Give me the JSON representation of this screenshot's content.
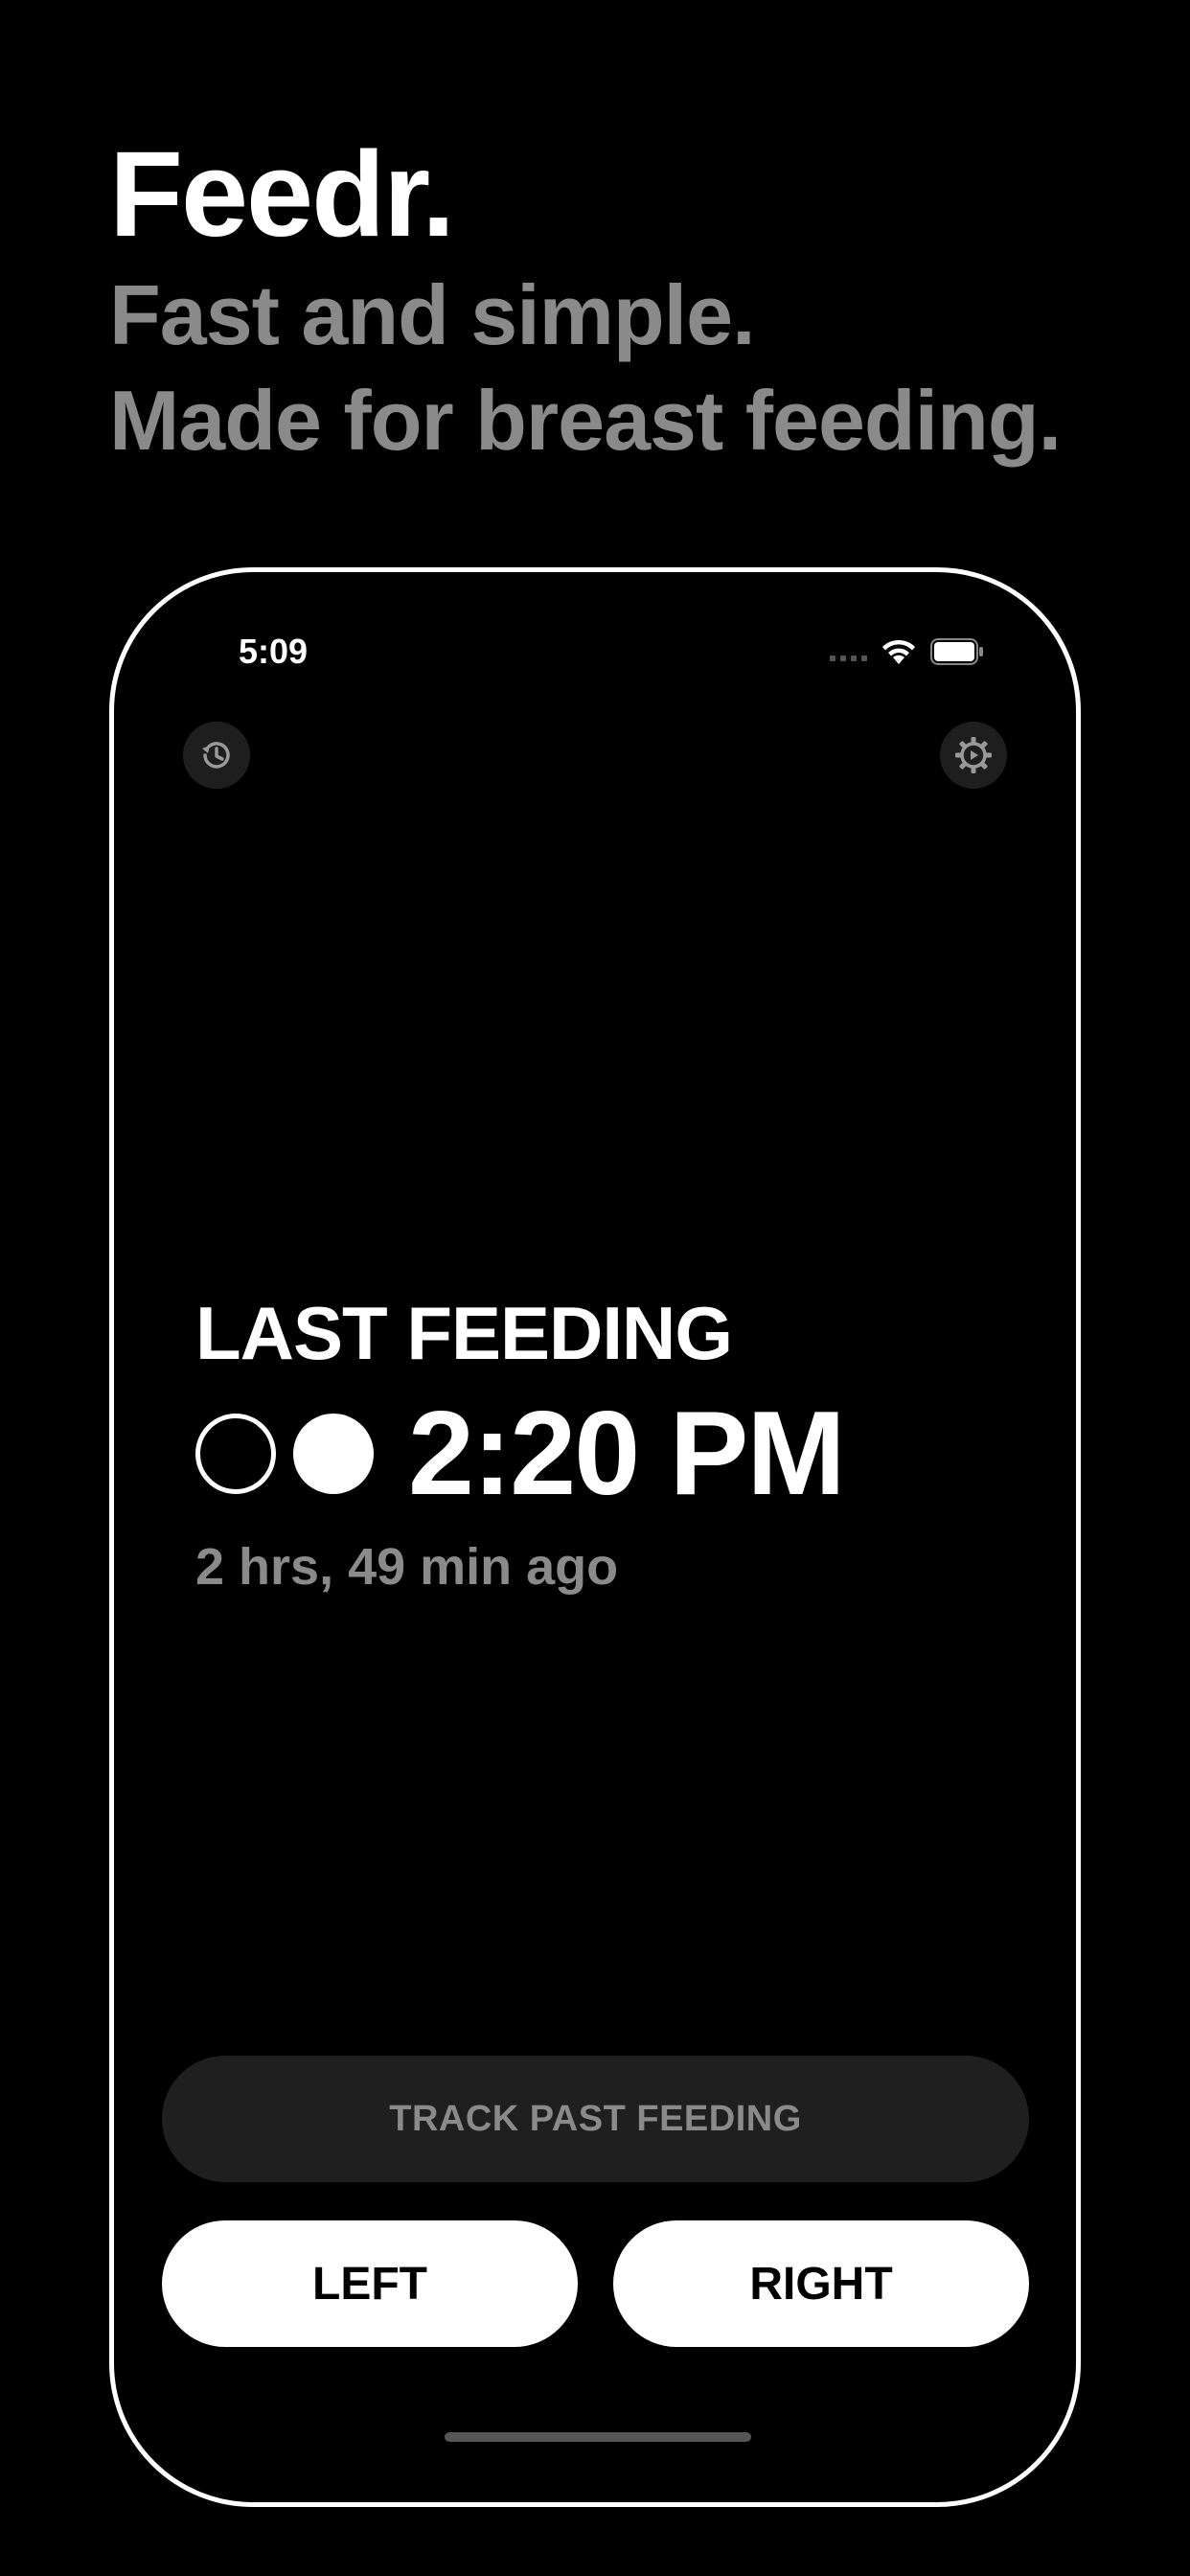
{
  "headline": {
    "brand": "Feedr.",
    "tagline_line1": "Fast and simple.",
    "tagline_line2": "Made for breast feeding."
  },
  "status_bar": {
    "time": "5:09",
    "icons": [
      "signal-dots-icon",
      "wifi-icon",
      "battery-icon"
    ]
  },
  "toolbar": {
    "history_icon": "history-icon",
    "settings_icon": "gear-icon"
  },
  "last_feeding": {
    "label": "LAST FEEDING",
    "indicators": [
      "empty",
      "filled"
    ],
    "time": "2:20 PM",
    "elapsed": "2 hrs, 49 min ago"
  },
  "actions": {
    "track_past": "TRACK PAST FEEDING",
    "left": "LEFT",
    "right": "RIGHT"
  },
  "colors": {
    "background": "#000000",
    "text": "#ffffff",
    "muted": "#8a8a8a",
    "button_dark": "#1f1f1f",
    "button_light": "#ffffff"
  }
}
